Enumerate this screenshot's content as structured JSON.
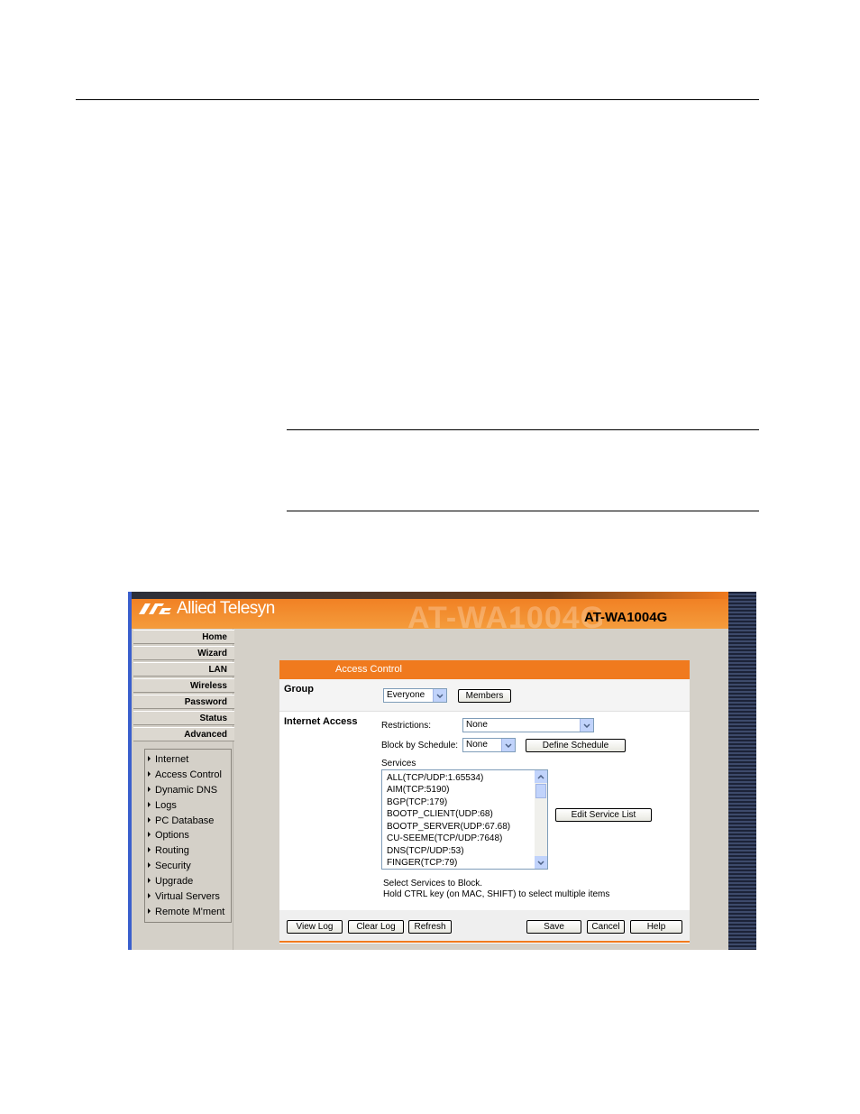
{
  "brand": {
    "company": "Allied Telesyn",
    "model": "AT-WA1004G",
    "watermark": "AT-WA1004G"
  },
  "nav": {
    "tabs": [
      "Home",
      "Wizard",
      "LAN",
      "Wireless",
      "Password",
      "Status",
      "Advanced"
    ],
    "submenu": [
      "Internet",
      "Access Control",
      "Dynamic DNS",
      "Logs",
      "PC Database",
      "Options",
      "Routing",
      "Security",
      "Upgrade",
      "Virtual Servers",
      "Remote M'ment"
    ]
  },
  "panel": {
    "title": "Access Control",
    "group_label": "Group",
    "group_value": "Everyone",
    "members_button": "Members",
    "internet_access_label": "Internet Access",
    "restrictions_label": "Restrictions:",
    "restrictions_value": "None",
    "block_schedule_label": "Block by Schedule:",
    "block_schedule_value": "None",
    "define_schedule_button": "Define Schedule",
    "services_label": "Services",
    "services": [
      "ALL(TCP/UDP:1.65534)",
      "AIM(TCP:5190)",
      "BGP(TCP:179)",
      "BOOTP_CLIENT(UDP:68)",
      "BOOTP_SERVER(UDP:67.68)",
      "CU-SEEME(TCP/UDP:7648)",
      "DNS(TCP/UDP:53)",
      "FINGER(TCP:79)"
    ],
    "edit_service_button": "Edit Service List",
    "hint_line1": "Select Services to Block.",
    "hint_line2": "Hold CTRL key (on MAC, SHIFT) to select multiple items"
  },
  "footer": {
    "view_log": "View Log",
    "clear_log": "Clear Log",
    "refresh": "Refresh",
    "save": "Save",
    "cancel": "Cancel",
    "help": "Help"
  },
  "colors": {
    "accent": "#f07a1e",
    "frame": "#d4d0c8",
    "scroll": "#c1d3fb"
  }
}
